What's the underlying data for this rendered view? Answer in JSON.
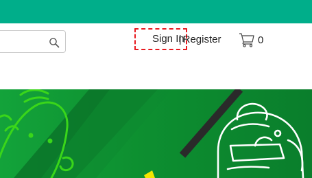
{
  "header": {
    "accent_color": "#00ae8a"
  },
  "search": {
    "value": "",
    "placeholder": "",
    "icon": "search-icon"
  },
  "account": {
    "sign_in_label": "Sign In",
    "separator": "|",
    "register_label": "Register"
  },
  "cart": {
    "icon": "cart-icon",
    "count": "0"
  },
  "banner": {
    "background_color": "#0a8a36",
    "accent_color": "#3ad61a"
  }
}
